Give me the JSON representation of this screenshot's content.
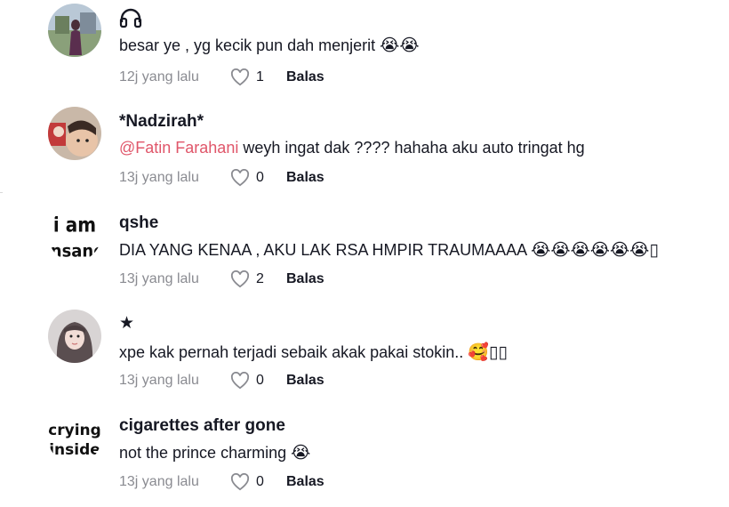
{
  "comments": [
    {
      "username": "",
      "username_icon": "headphones-icon",
      "text": "besar ye , yg kecik pun dah menjerit",
      "emojis": "😭😭",
      "time": "12j yang lalu",
      "likes": "1",
      "reply": "Balas"
    },
    {
      "username": "*Nadzirah*",
      "mention": "@Fatin Farahani",
      "text": " weyh ingat dak ???? hahaha aku auto tringat hg",
      "emojis": "",
      "time": "13j yang lalu",
      "likes": "0",
      "reply": "Balas"
    },
    {
      "username": "qshe",
      "avatar_text": [
        "i am",
        "insane"
      ],
      "text": "DIA YANG KENAA , AKU LAK RSA HMPIR TRAUMAAAA",
      "emojis": "😭😭😭😭😭😭▯",
      "time": "13j yang lalu",
      "likes": "2",
      "reply": "Balas"
    },
    {
      "username": "★",
      "text": "xpe kak pernah terjadi sebaik akak pakai stokin..",
      "emojis": "🥰▯▯",
      "time": "13j yang lalu",
      "likes": "0",
      "reply": "Balas"
    },
    {
      "username": "cigarettes after gone",
      "avatar_text": [
        "crying",
        "inside"
      ],
      "text": "not the prince charming",
      "emojis": "😭",
      "time": "13j yang lalu",
      "likes": "0",
      "reply": "Balas"
    }
  ]
}
